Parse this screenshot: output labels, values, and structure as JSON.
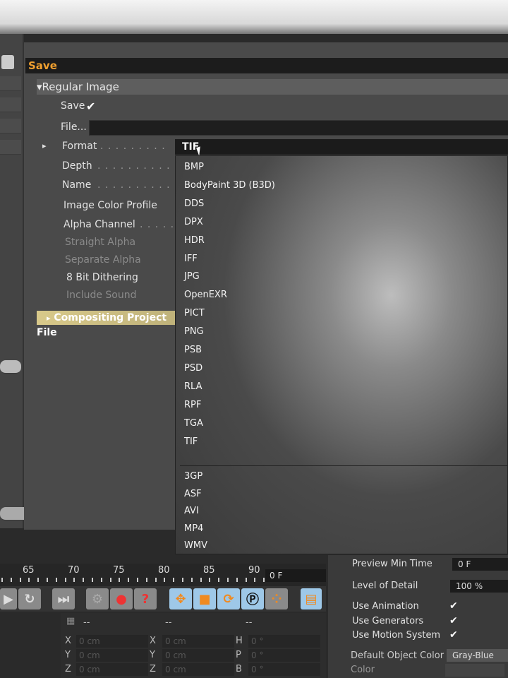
{
  "header": {
    "title": "Save"
  },
  "section": {
    "title": "Regular Image",
    "compositing": "Compositing Project File"
  },
  "fields": {
    "save_label": "Save",
    "save_checked": true,
    "file_label": "File...",
    "file_value": "",
    "format_label": "Format",
    "format_value": "TIF",
    "depth_label": "Depth",
    "name_label": "Name",
    "color_profile_label": "Image Color Profile",
    "alpha_label": "Alpha Channel",
    "straight_alpha_label": "Straight Alpha",
    "separate_alpha_label": "Separate Alpha",
    "dithering_label": "8 Bit Dithering",
    "sound_label": "Include Sound"
  },
  "format_menu": {
    "image_formats": [
      "BMP",
      "BodyPaint 3D (B3D)",
      "DDS",
      "DPX",
      "HDR",
      "IFF",
      "JPG",
      "OpenEXR",
      "PICT",
      "PNG",
      "PSB",
      "PSD",
      "RLA",
      "RPF",
      "TGA",
      "TIF"
    ],
    "movie_formats": [
      "3GP",
      "ASF",
      "AVI",
      "MP4",
      "WMV"
    ]
  },
  "timeline": {
    "ticks": [
      "65",
      "70",
      "75",
      "80",
      "85",
      "90"
    ],
    "frame": "0 F"
  },
  "coords": {
    "headers": [
      "--",
      "--",
      "--"
    ],
    "rows": [
      {
        "a": "X",
        "av": "0 cm",
        "b": "X",
        "bv": "0 cm",
        "c": "H",
        "cv": "0 °"
      },
      {
        "a": "Y",
        "av": "0 cm",
        "b": "Y",
        "bv": "0 cm",
        "c": "P",
        "cv": "0 °"
      },
      {
        "a": "Z",
        "av": "0 cm",
        "b": "Z",
        "bv": "0 cm",
        "c": "B",
        "cv": "0 °"
      }
    ]
  },
  "project": {
    "preview_min_label": "Preview Min Time",
    "preview_min_value": "0 F",
    "lod_label": "Level of Detail",
    "lod_value": "100 %",
    "use_animation": "Use Animation",
    "use_generators": "Use Generators",
    "use_motion": "Use Motion System",
    "default_color_label": "Default Object Color",
    "default_color_value": "Gray-Blue",
    "color_label": "Color"
  },
  "icons": {
    "check": "✔",
    "arrow_right": "▸",
    "arrow_down": "▾"
  },
  "colors": {
    "accent": "#f0a030",
    "highlight": "#d8c98a"
  }
}
